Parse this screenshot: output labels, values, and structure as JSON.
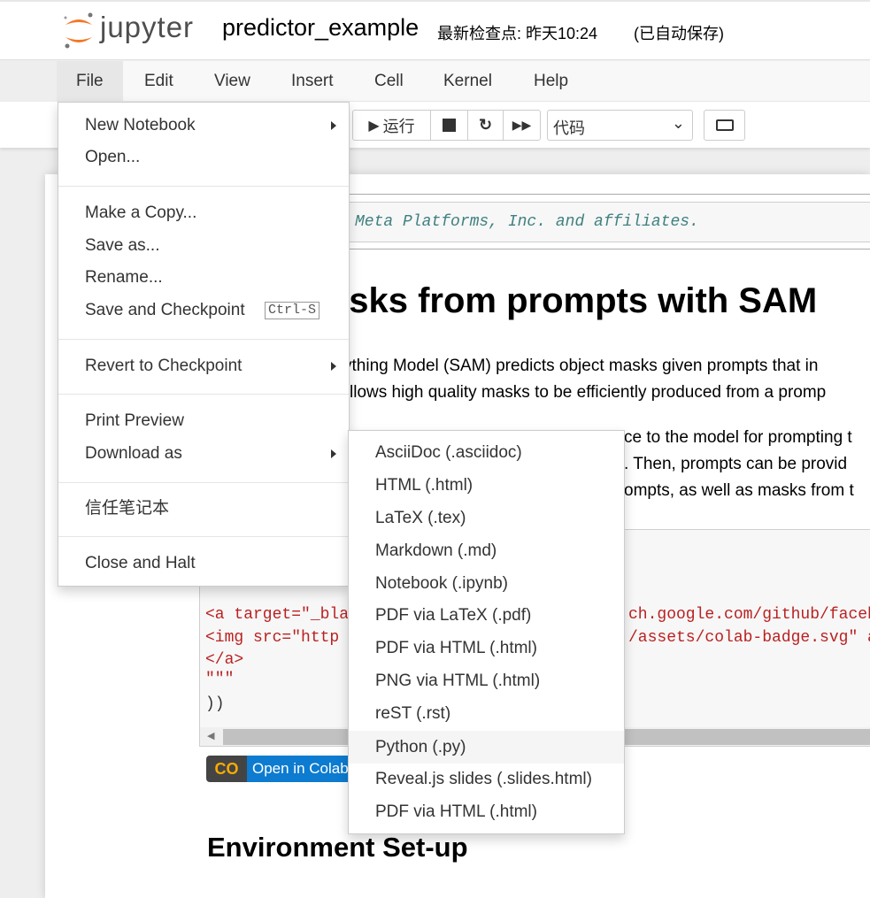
{
  "header": {
    "logo_text": "jupyter",
    "notebook_name": "predictor_example",
    "checkpoint": "最新检查点: 昨天10:24",
    "autosave": "(已自动保存)"
  },
  "menubar": [
    {
      "label": "File"
    },
    {
      "label": "Edit"
    },
    {
      "label": "View"
    },
    {
      "label": "Insert"
    },
    {
      "label": "Cell"
    },
    {
      "label": "Kernel"
    },
    {
      "label": "Help"
    }
  ],
  "toolbar": {
    "run_label": "运行",
    "cell_type": "代码",
    "icons": [
      "run-icon",
      "stop-icon",
      "restart-icon",
      "fast-forward-icon",
      "keyboard-icon"
    ]
  },
  "file_menu": {
    "items": [
      {
        "label": "New Notebook",
        "submenu": true
      },
      {
        "label": "Open..."
      },
      {
        "label": "Make a Copy..."
      },
      {
        "label": "Save as..."
      },
      {
        "label": "Rename..."
      },
      {
        "label": "Save and Checkpoint",
        "shortcut": "Ctrl-S"
      },
      {
        "label": "Revert to Checkpoint",
        "submenu": true
      },
      {
        "label": "Print Preview"
      },
      {
        "label": "Download as",
        "submenu": true
      },
      {
        "label": "信任笔记本"
      },
      {
        "label": "Close and Halt"
      }
    ]
  },
  "download_menu": {
    "items": [
      "AsciiDoc (.asciidoc)",
      "HTML (.html)",
      "LaTeX (.tex)",
      "Markdown (.md)",
      "Notebook (.ipynb)",
      "PDF via LaTeX (.pdf)",
      "PDF via HTML (.html)",
      "PNG via HTML (.html)",
      "reST (.rst)",
      "Python (.py)",
      "Reveal.js slides (.slides.html)",
      "PDF via HTML (.html)"
    ],
    "highlighted": "Python (.py)"
  },
  "notebook": {
    "cell1_code": "Meta Platforms, Inc. and affiliates.",
    "title": "asks from prompts with SAM",
    "para1": [
      "ything Model (SAM) predicts object masks given prompts that in",
      "llows high quality masks to be efficiently produced from a promp"
    ],
    "para2": [
      "ce to the model for prompting t",
      ". Then, prompts can be provid",
      "ompts, as well as masks from t"
    ],
    "code_lines": [
      "\"\"\"",
      "<a target=\"_blan",
      "  <img src=\"http",
      "</a>",
      "\"\"\"",
      "))"
    ],
    "code_right": [
      "ch.google.com/github/facebo",
      "/assets/colab-badge.svg\" al"
    ],
    "colab_badge": "Open in Colab",
    "section_title": "Environment Set-up"
  },
  "colors": {
    "accent_orange": "#f37726",
    "code_string": "#ba2121",
    "comment": "#408080",
    "colab_blue": "#0c7bd0"
  }
}
